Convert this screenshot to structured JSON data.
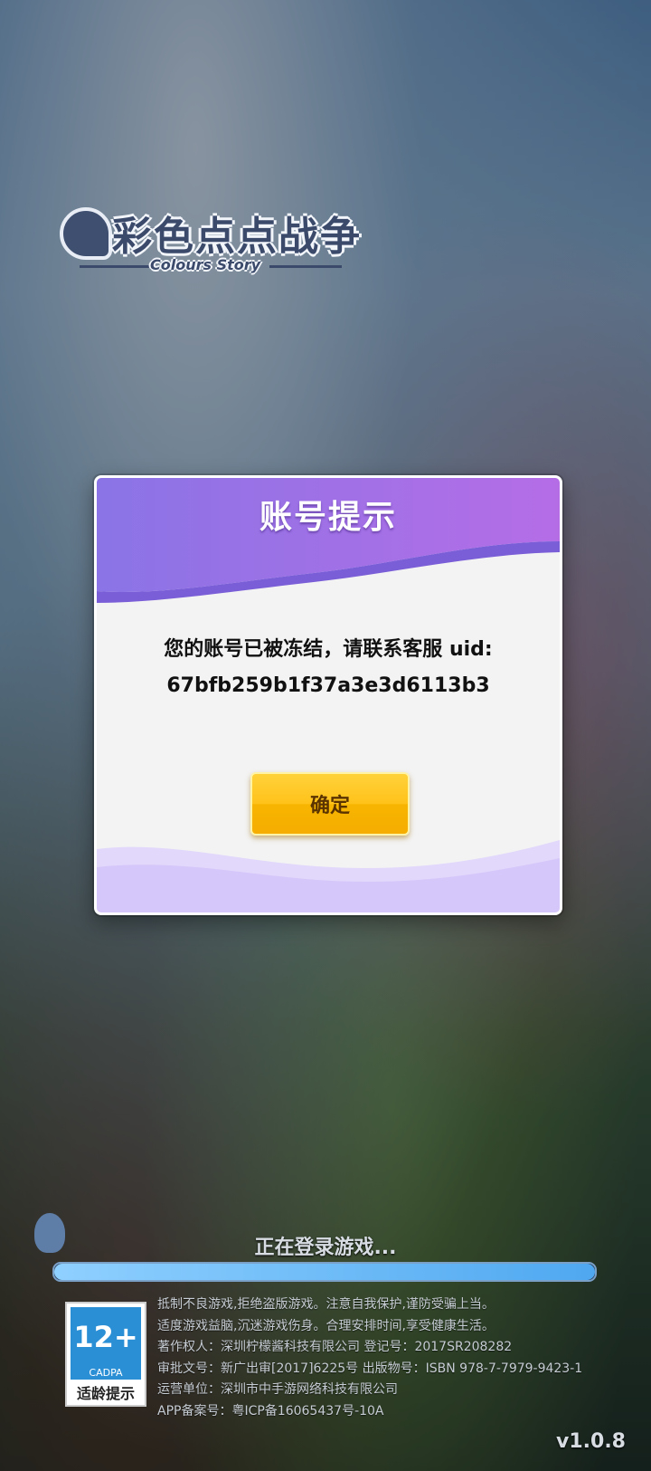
{
  "logo": {
    "title": "彩色点点战争",
    "subtitle": "Colours Story"
  },
  "dialog": {
    "title": "账号提示",
    "message_line1": "您的账号已被冻结，请联系客服 uid:",
    "message_line2": "67bfb259b1f37a3e3d6113b3",
    "confirm_label": "确定"
  },
  "loading": {
    "text": "正在登录游戏...",
    "progress": 1.0
  },
  "age_rating": {
    "age": "12+",
    "org": "CADPA",
    "label": "适龄提示"
  },
  "legal": [
    "抵制不良游戏,拒绝盗版游戏。注意自我保护,谨防受骗上当。",
    "适度游戏益脑,沉迷游戏伤身。合理安排时间,享受健康生活。",
    "著作权人：深圳柠檬酱科技有限公司 登记号：2017SR208282",
    "审批文号：新广出审[2017]6225号 出版物号：ISBN 978-7-7979-9423-1",
    "运营单位：深圳市中手游网络科技有限公司",
    "APP备案号：粤ICP备16065437号-10A"
  ],
  "version": "v1.0.8",
  "colors": {
    "dialog_header_purple": "#8f6fe8",
    "confirm_yellow": "#ffc21a",
    "loading_fill": "#4fa8f0"
  }
}
